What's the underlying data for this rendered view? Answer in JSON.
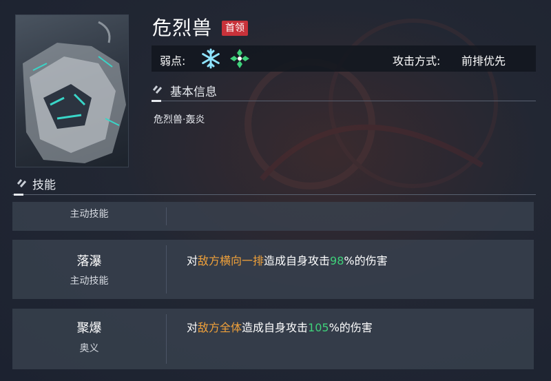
{
  "enemy": {
    "name": "危烈兽",
    "badge": "首领",
    "weakness_label": "弱点:",
    "weakness_icons": [
      "ice-element-icon",
      "wind-element-icon"
    ],
    "attack_mode_label": "攻击方式:",
    "attack_mode_value": "前排优先"
  },
  "basic_info": {
    "title": "基本信息",
    "text": "危烈兽·轰炎"
  },
  "skills": {
    "title": "技能",
    "rows": [
      {
        "name": "",
        "type": "主动技能",
        "desc_parts": []
      },
      {
        "name": "落瀑",
        "type": "主动技能",
        "desc_parts": [
          {
            "text": "对",
            "style": ""
          },
          {
            "text": "敌方横向一排",
            "style": "orange"
          },
          {
            "text": "造成自身攻击",
            "style": ""
          },
          {
            "text": "98",
            "style": "green"
          },
          {
            "text": "%的伤害",
            "style": ""
          }
        ]
      },
      {
        "name": "聚爆",
        "type": "奥义",
        "desc_parts": [
          {
            "text": "对",
            "style": ""
          },
          {
            "text": "敌方全体",
            "style": "orange"
          },
          {
            "text": "造成自身攻击",
            "style": ""
          },
          {
            "text": "105",
            "style": "green"
          },
          {
            "text": "%的伤害",
            "style": ""
          }
        ]
      }
    ]
  },
  "colors": {
    "badge_red": "#c8323a",
    "highlight_orange": "#f0a13a",
    "highlight_green": "#3fd17a",
    "ice_blue": "#8fe4ff",
    "wind_green": "#3fd17a"
  }
}
